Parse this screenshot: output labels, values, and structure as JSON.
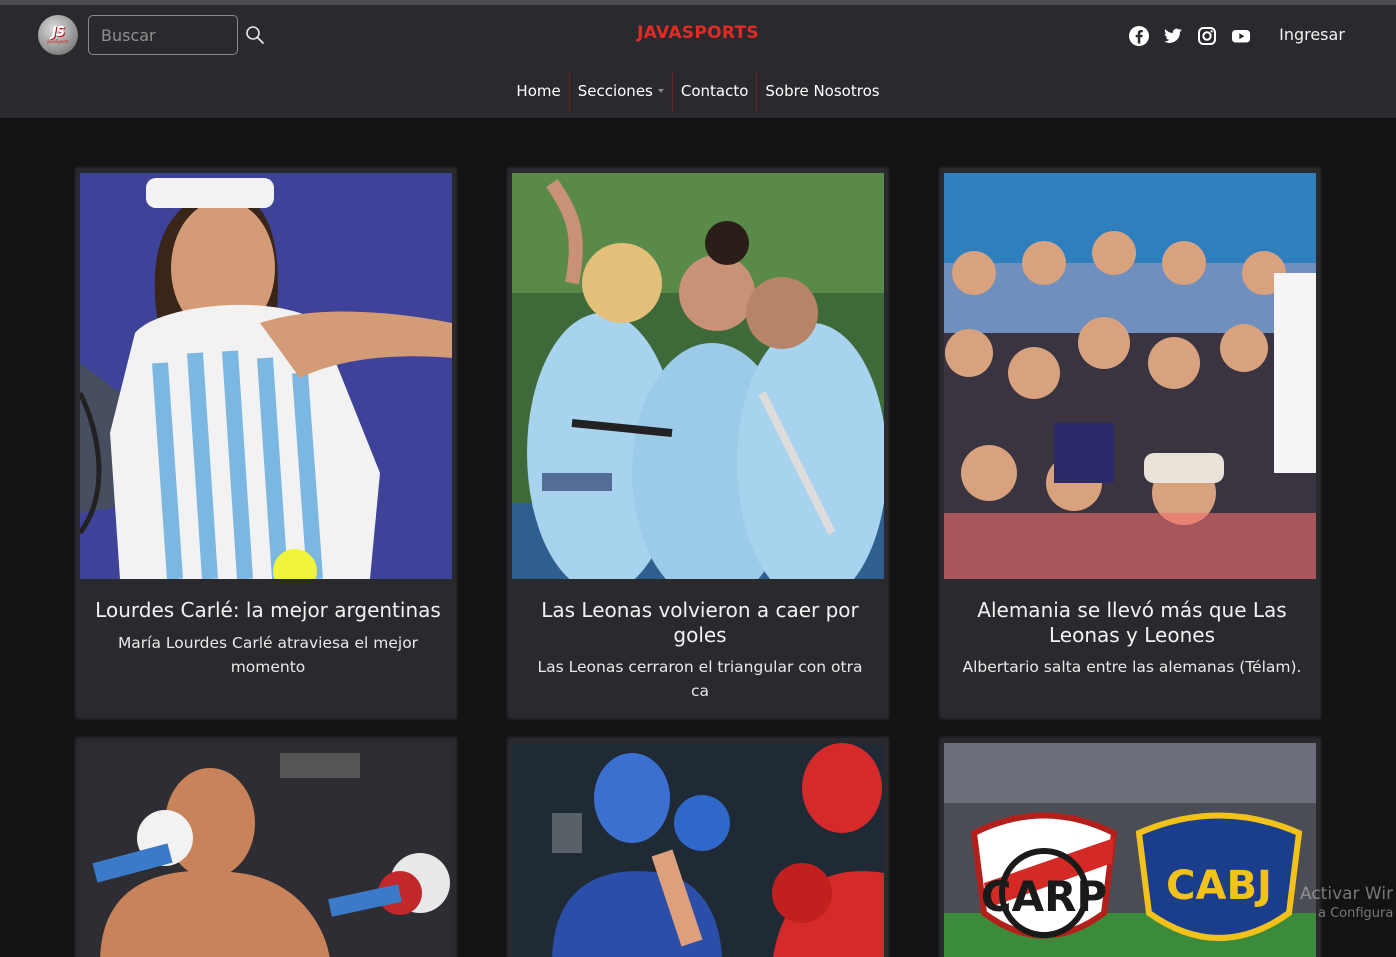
{
  "header": {
    "logo_text": "JS",
    "logo_sub": "JavaSports",
    "search_placeholder": "Buscar",
    "brand": "JAVASPORTS",
    "login_label": "Ingresar",
    "social": [
      "facebook-icon",
      "twitter-icon",
      "instagram-icon",
      "youtube-icon"
    ]
  },
  "nav": {
    "items": [
      "Home",
      "Secciones",
      "Contacto",
      "Sobre Nosotros"
    ]
  },
  "cards": [
    {
      "title": "Lourdes Carlé: la mejor argentinas",
      "desc": "María Lourdes Carlé atraviesa el mejor momento",
      "image": "tennis-player-photo"
    },
    {
      "title": "Las Leonas volvieron a caer por goles",
      "desc": "Las Leonas cerraron el triangular con otra ca",
      "image": "hockey-team-celebration-photo"
    },
    {
      "title": "Alemania se llevó más que Las Leonas y Leones",
      "desc": "Albertario salta entre las alemanas (Télam).",
      "image": "fans-crowd-photo"
    },
    {
      "image": "boxer-photo"
    },
    {
      "image": "amateur-boxing-photo"
    },
    {
      "image": "river-boca-crests-photo"
    }
  ],
  "watermark": {
    "line1": "Activar Wir",
    "line2": "a Configura"
  },
  "colors": {
    "brand": "#e22b25",
    "header_bg": "#2a292e",
    "page_bg": "#131313",
    "card_bg": "#2a292e"
  }
}
